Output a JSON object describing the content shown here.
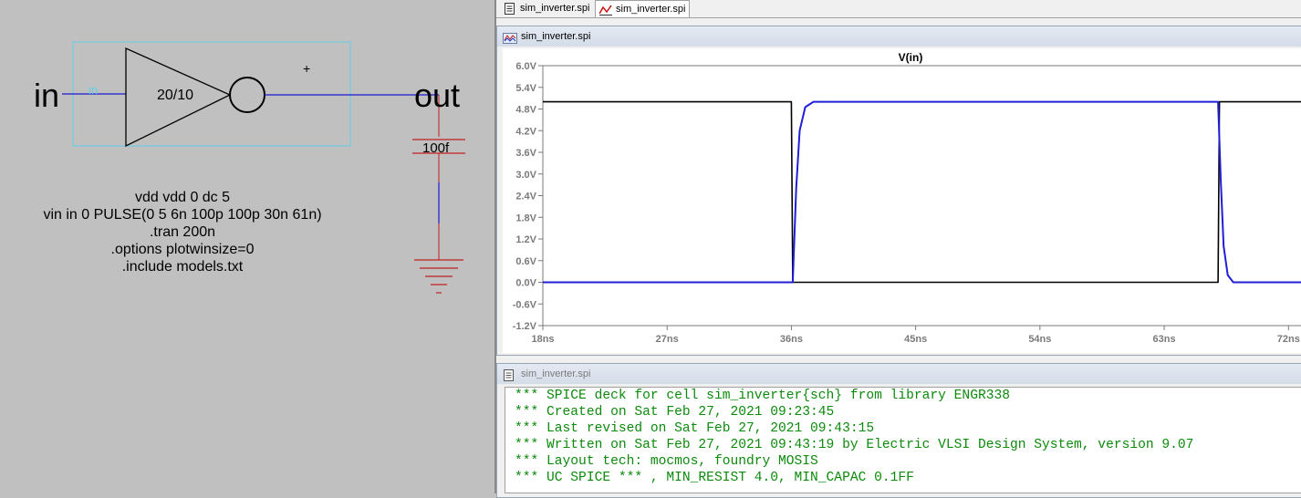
{
  "schematic": {
    "labels": {
      "in": "in",
      "out": "out",
      "inverter_size": "20/10",
      "cap_value": "100f",
      "port_small": "in",
      "plus": "+"
    },
    "deck": [
      "vdd vdd 0 dc 5",
      "vin in 0 PULSE(0 5 6n 100p 100p 30n 61n)",
      ".tran 200n",
      ".options plotwinsize=0",
      ".include models.txt"
    ]
  },
  "tabs": [
    {
      "label": "sim_inverter.spi",
      "icon": "document-icon",
      "active": false
    },
    {
      "label": "sim_inverter.spi",
      "icon": "waveform-icon",
      "active": true
    }
  ],
  "plot_window": {
    "title": "sim_inverter.spi",
    "icon": "waveform-icon"
  },
  "netlist_window": {
    "title": "sim_inverter.spi",
    "icon": "document-icon",
    "lines": [
      "*** SPICE deck for cell sim_inverter{sch} from library ENGR338",
      "*** Created on Sat Feb 27, 2021 09:23:45",
      "*** Last revised on Sat Feb 27, 2021 09:43:15",
      "*** Written on Sat Feb 27, 2021 09:43:19 by Electric VLSI Design System, version 9.07",
      "*** Layout tech: mocmos, foundry MOSIS",
      "*** UC SPICE *** , MIN_RESIST 4.0, MIN_CAPAC 0.1FF"
    ]
  },
  "chart_data": {
    "type": "line",
    "title": "V(in)",
    "xlabel": "",
    "ylabel": "",
    "xlim": [
      18,
      73.5
    ],
    "ylim": [
      -1.2,
      6.0
    ],
    "x_ticks": [
      18,
      27,
      36,
      45,
      54,
      63,
      72
    ],
    "x_tick_labels": [
      "18ns",
      "27ns",
      "36ns",
      "45ns",
      "54ns",
      "63ns",
      "72ns"
    ],
    "y_ticks": [
      6.0,
      5.4,
      4.8,
      4.2,
      3.6,
      3.0,
      2.4,
      1.8,
      1.2,
      0.6,
      0.0,
      -0.6,
      -1.2
    ],
    "y_tick_labels": [
      "6.0V",
      "5.4V",
      "4.8V",
      "4.2V",
      "3.6V",
      "3.0V",
      "2.4V",
      "1.8V",
      "1.2V",
      "0.6V",
      "0.0V",
      "-0.6V",
      "-1.2V"
    ],
    "grid": false,
    "series": [
      {
        "color": "#000000",
        "x": [
          18,
          36.0,
          36.1,
          66.9,
          67.0,
          73.5
        ],
        "y": [
          5,
          5,
          0,
          0,
          5,
          5
        ]
      },
      {
        "color": "#1f1fd6",
        "x": [
          18,
          36.1,
          36.35,
          36.6,
          37.0,
          37.6,
          66.9,
          67.1,
          67.3,
          67.6,
          68.0,
          73.5
        ],
        "y": [
          0,
          0,
          2.6,
          4.2,
          4.85,
          5,
          5,
          2.8,
          1.0,
          0.2,
          0,
          0
        ]
      }
    ]
  }
}
